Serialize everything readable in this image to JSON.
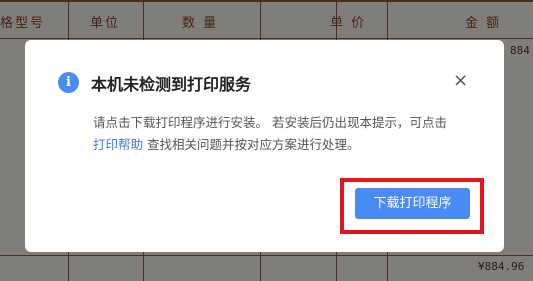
{
  "invoice": {
    "headers": [
      "格型号",
      "单位",
      "数 量",
      "单 价",
      "金 额"
    ],
    "amount_right": "884",
    "total": "¥884.96"
  },
  "dialog": {
    "icon": "info-icon",
    "title": "本机未检测到打印服务",
    "close_label": "×",
    "message_part1": "请点击下载打印程序进行安装。 若安装后仍出现本提示，可点击 ",
    "help_link": "打印帮助",
    "message_part2": " 查找相关问题并按对应方案进行处理。",
    "download_button": "下载打印程序"
  },
  "colors": {
    "accent": "#4a8af4",
    "highlight": "#e8121c",
    "table_line": "#9b5b3a"
  }
}
